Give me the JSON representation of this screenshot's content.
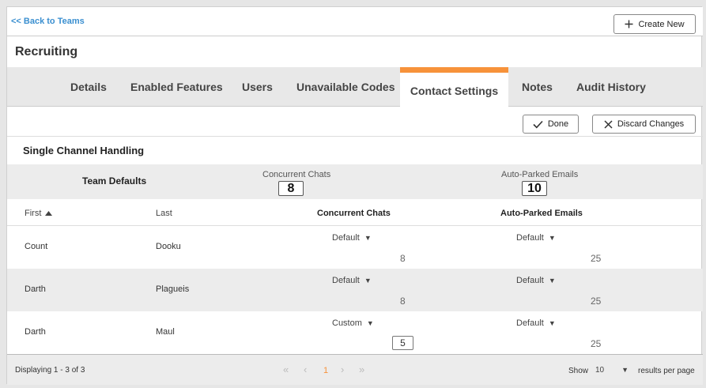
{
  "nav": {
    "back_label": "<< Back to Teams",
    "create_label": "Create New"
  },
  "page": {
    "title": "Recruiting"
  },
  "tabs": [
    "Details",
    "Enabled Features",
    "Users",
    "Unavailable Codes",
    "Contact Settings",
    "Notes",
    "Audit History"
  ],
  "actions": {
    "done_label": "Done",
    "discard_label": "Discard Changes"
  },
  "section": {
    "title": "Single Channel Handling",
    "defaults_label": "Team Defaults",
    "concurrent_label": "Concurrent Chats",
    "concurrent_value": "8",
    "parked_label": "Auto-Parked Emails",
    "parked_value": "10"
  },
  "table": {
    "headers": {
      "first": "First",
      "last": "Last",
      "concurrent": "Concurrent Chats",
      "parked": "Auto-Parked Emails"
    },
    "rows": [
      {
        "first": "Count",
        "last": "Dooku",
        "chat_mode": "Default",
        "chat_value": "8",
        "email_mode": "Default",
        "email_value": "25"
      },
      {
        "first": "Darth",
        "last": "Plagueis",
        "chat_mode": "Default",
        "chat_value": "8",
        "email_mode": "Default",
        "email_value": "25"
      },
      {
        "first": "Darth",
        "last": "Maul",
        "chat_mode": "Custom",
        "chat_value": "5",
        "email_mode": "Default",
        "email_value": "25"
      }
    ]
  },
  "footer": {
    "displaying": "Displaying 1 - 3 of 3",
    "pager": {
      "first": "«",
      "prev": "‹",
      "page": "1",
      "next": "›",
      "last": "»"
    },
    "show_label": "Show",
    "page_size": "10",
    "per_page_label": "results per page"
  },
  "colors": {
    "accent": "#f7923a",
    "link": "#3a8fd0",
    "band": "#ececec"
  },
  "icons": [
    "plus-icon",
    "check-icon",
    "close-icon",
    "sort-up-icon",
    "caret-down-icon"
  ]
}
